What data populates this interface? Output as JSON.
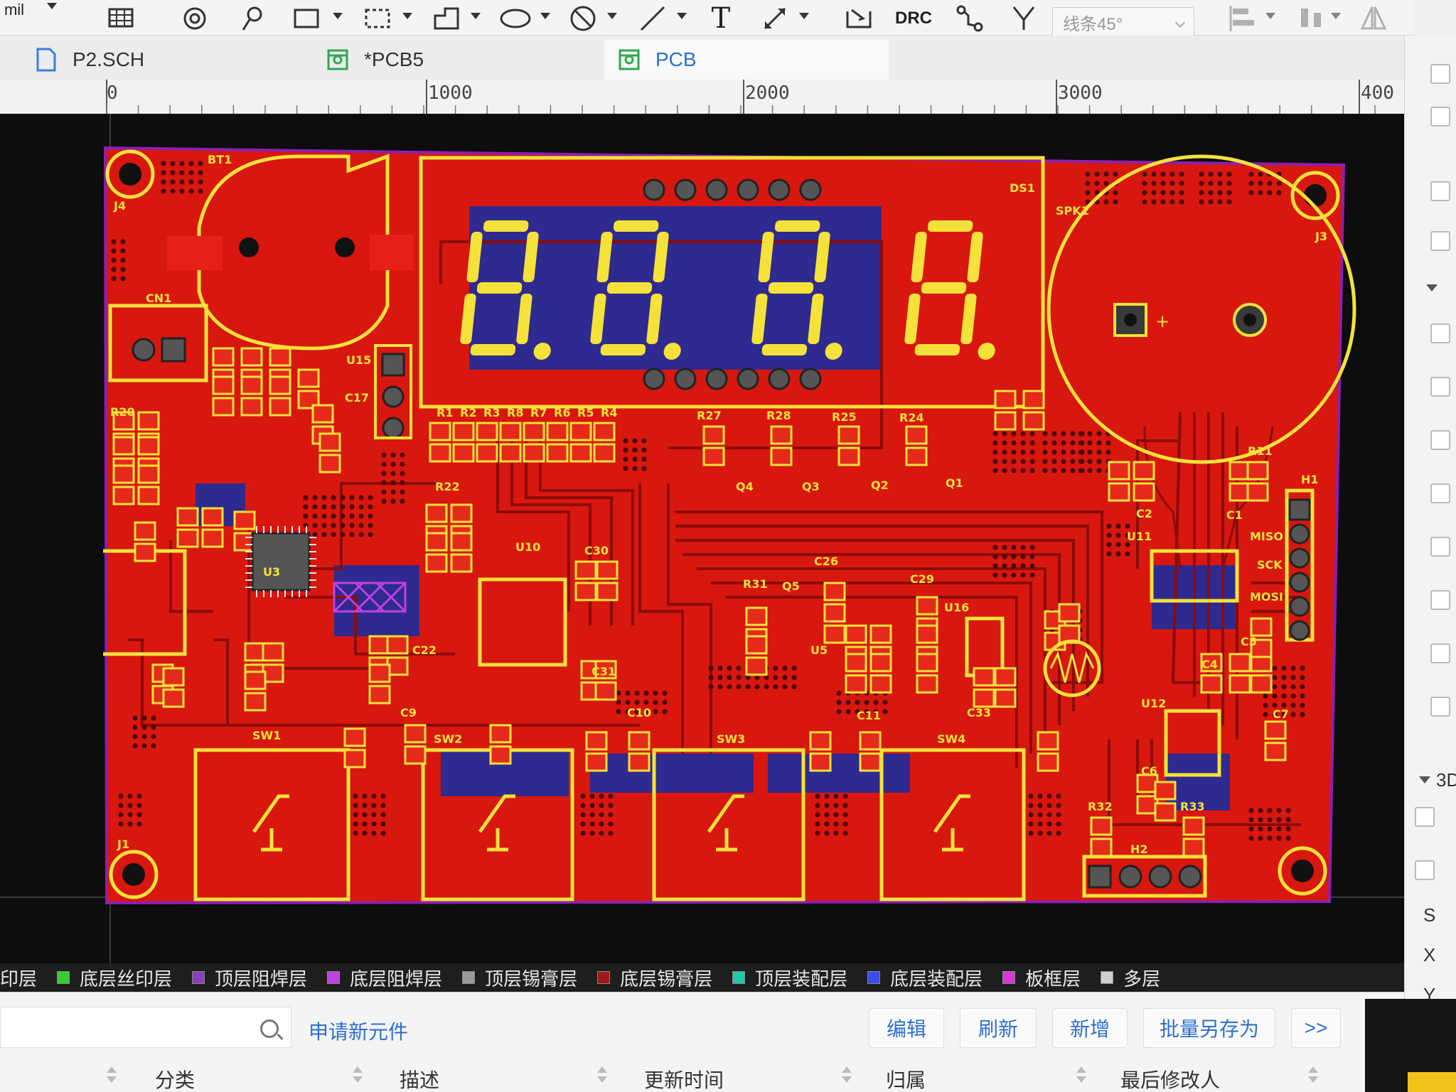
{
  "toolbar": {
    "drc_label": "DRC",
    "text_tool_label": "T",
    "routing_mode": "线条45°",
    "partial_label": "mil"
  },
  "tabs": [
    {
      "label": "P2.SCH",
      "type": "schematic"
    },
    {
      "label": "*PCB5",
      "type": "pcb"
    },
    {
      "label": "PCB",
      "type": "pcb"
    }
  ],
  "ruler": {
    "marks": [
      "0",
      "1000",
      "2000",
      "3000",
      "400"
    ]
  },
  "board": {
    "display": {
      "digit1": "8",
      "digit2": "8",
      "digit3": "8",
      "digit4": "8"
    },
    "labels": {
      "bt1": "BT1",
      "ds1": "DS1",
      "spk1": "SPK1",
      "cn1": "CN1",
      "u15": "U15",
      "u3": "U3",
      "u10": "U10",
      "u11": "U11",
      "u12": "U12",
      "u5": "U5",
      "u16": "U16",
      "h1": "H1",
      "h2": "H2",
      "sw1": "SW1",
      "sw2": "SW2",
      "sw3": "SW3",
      "sw4": "SW4",
      "q1": "Q1",
      "q2": "Q2",
      "q3": "Q3",
      "q4": "Q4",
      "q5": "Q5",
      "r27": "R27",
      "r28": "R28",
      "r25": "R25",
      "r24": "R24",
      "r22": "R22",
      "r20": "R20",
      "r31": "R31",
      "r32": "R32",
      "r33": "R33",
      "r11": "R11",
      "c1": "C1",
      "c2": "C2",
      "c26": "C26",
      "c29": "C29",
      "c30": "C30",
      "c31": "C31",
      "c33": "C33",
      "c6": "C6",
      "c7": "C7",
      "c4": "C4",
      "c5": "C5",
      "c9": "C9",
      "c10": "C10",
      "c11": "C11",
      "c22": "C22",
      "c17": "C17",
      "r1": "R1",
      "r2": "R2",
      "r3": "R3",
      "r8": "R8",
      "r7": "R7",
      "r6": "R6",
      "r5": "R5",
      "r4": "R4",
      "miso": "MISO",
      "sck": "SCK",
      "mosi": "MOSI",
      "j1": "J1",
      "j3": "J3",
      "j4": "J4"
    }
  },
  "right_panel": {
    "s": "S",
    "x": "X",
    "y": "Y",
    "s_val": "3D"
  },
  "layers": [
    {
      "name": "印层",
      "color": "#bfbfbf"
    },
    {
      "name": "底层丝印层",
      "color": "#33cc33"
    },
    {
      "name": "顶层阻焊层",
      "color": "#8a3fbf"
    },
    {
      "name": "底层阻焊层",
      "color": "#c040e0"
    },
    {
      "name": "顶层锡膏层",
      "color": "#9a9a9a"
    },
    {
      "name": "底层锡膏层",
      "color": "#a01818"
    },
    {
      "name": "顶层装配层",
      "color": "#22c7a6"
    },
    {
      "name": "底层装配层",
      "color": "#3a4df0"
    },
    {
      "name": "板框层",
      "color": "#d838d8"
    },
    {
      "name": "多层",
      "color": "#cfcfcf"
    }
  ],
  "bottom": {
    "apply_link": "申请新元件",
    "buttons": [
      "编辑",
      "刷新",
      "新增",
      "批量另存为",
      ">>"
    ],
    "columns": [
      "分类",
      "描述",
      "更新时间",
      "归属",
      "最后修改人"
    ]
  },
  "colors": {
    "board": "#d8170f",
    "silk": "#f4e23a",
    "bottom_copper": "#2f2a8f",
    "frame": "#8c1fb0"
  }
}
